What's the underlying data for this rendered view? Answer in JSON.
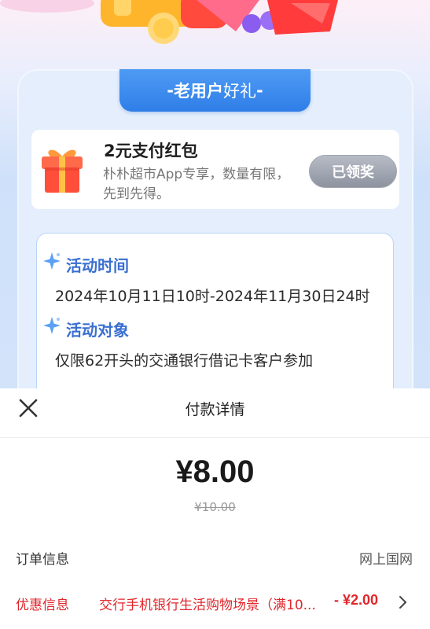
{
  "promo": {
    "header": {
      "dash_left": "- ",
      "title_bold": "老用户",
      "title_thin": "好礼",
      "dash_right": " -"
    },
    "reward": {
      "title": "2元支付红包",
      "description": "朴朴超市App专享，数量有限，先到先得。",
      "button_label": "已领奖"
    },
    "activity_time": {
      "title": "活动时间",
      "value": "2024年10月11日10时-2024年11月30日24时"
    },
    "activity_target": {
      "title": "活动对象",
      "value": "仅限62开头的交通银行借记卡客户参加"
    }
  },
  "payment_sheet": {
    "title": "付款详情",
    "amount": "¥8.00",
    "original_amount": "¥10.00",
    "order_info": {
      "label": "订单信息",
      "value": "网上国网"
    },
    "discount": {
      "label": "优惠信息",
      "description": "交行手机银行生活购物场景（满10...",
      "value": "- ¥2.00"
    }
  },
  "colors": {
    "accent_blue": "#2f7ee8",
    "discount_red": "#e0262c",
    "claimed_gray": "#8d939f"
  },
  "icons": [
    "gift-icon",
    "sparkle-icon",
    "close-icon",
    "chevron-right-icon"
  ]
}
